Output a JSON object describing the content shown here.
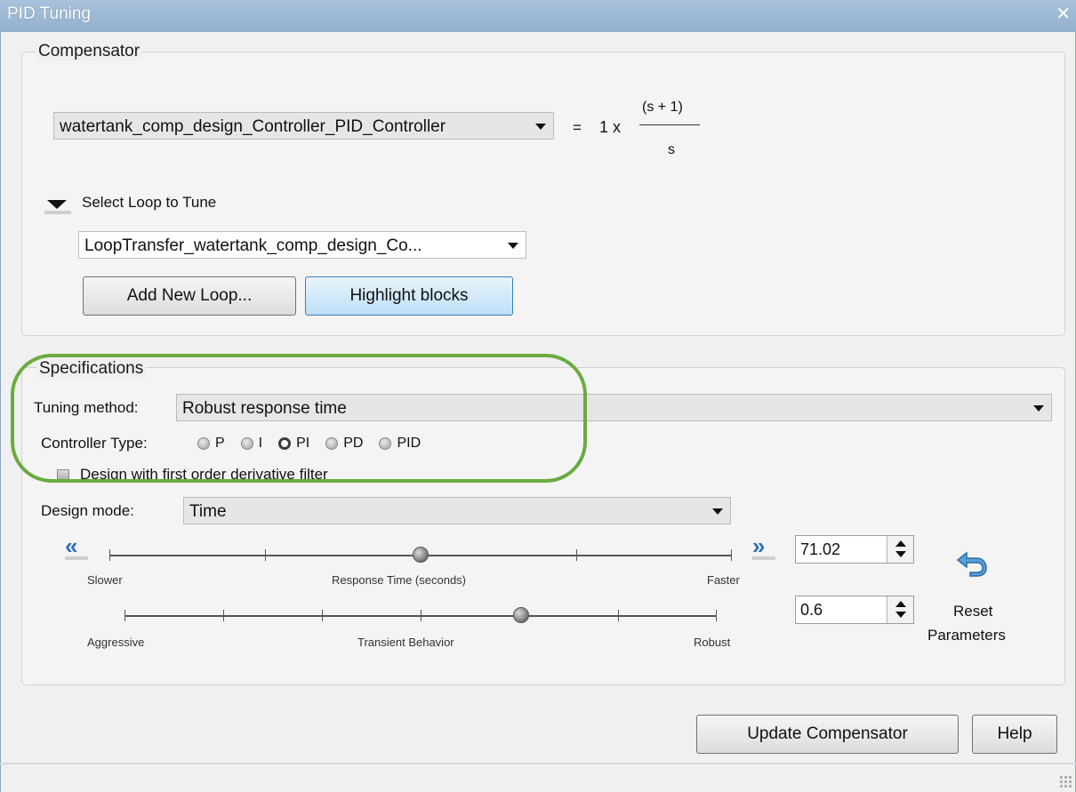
{
  "window": {
    "title": "PID Tuning",
    "close_glyph": "✕"
  },
  "compensator": {
    "legend": "Compensator",
    "block_selected": "watertank_comp_design_Controller_PID_Controller",
    "equals": "=",
    "gain": "1 x",
    "numerator": "(s + 1)",
    "denominator": "s",
    "loop_toggle_label": "Select Loop to Tune",
    "loop_selected": "LoopTransfer_watertank_comp_design_Co...",
    "add_loop_label": "Add New Loop...",
    "highlight_label": "Highlight blocks"
  },
  "specifications": {
    "legend": "Specifications",
    "tuning_method_label": "Tuning method:",
    "tuning_method_value": "Robust response time",
    "controller_type_label": "Controller Type:",
    "controller_types": [
      {
        "label": "P",
        "selected": false
      },
      {
        "label": "I",
        "selected": false
      },
      {
        "label": "PI",
        "selected": true
      },
      {
        "label": "PD",
        "selected": false
      },
      {
        "label": "PID",
        "selected": false
      }
    ],
    "derivative_filter_label": "Design with first order derivative filter",
    "design_mode_label": "Design mode:",
    "design_mode_value": "Time",
    "response_time": {
      "left_caption": "Slower",
      "center_caption": "Response Time (seconds)",
      "right_caption": "Faster",
      "value": "71.02",
      "thumb_fraction": 0.5
    },
    "transient": {
      "left_caption": "Aggressive",
      "center_caption": "Transient Behavior",
      "right_caption": "Robust",
      "value": "0.6",
      "thumb_fraction": 0.67
    },
    "reset_label_line1": "Reset",
    "reset_label_line2": "Parameters",
    "reset_icon": "undo-arrow-icon"
  },
  "footer": {
    "update_label": "Update Compensator",
    "help_label": "Help"
  },
  "colors": {
    "title_bar": "#9ab5d1",
    "highlight_ring": "#6aab3e",
    "chevron": "#2f6fbe"
  }
}
